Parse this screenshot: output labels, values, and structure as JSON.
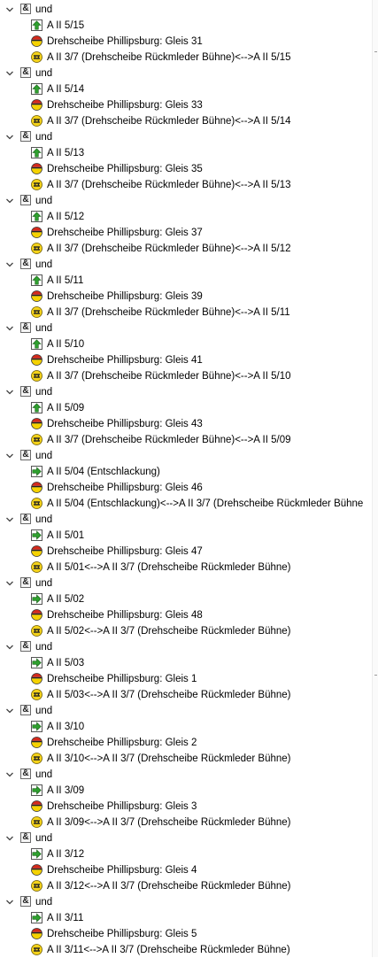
{
  "tree": {
    "groups": [
      {
        "op": "und",
        "green_kind": "up",
        "green": "A II 5/15",
        "gleis": "Drehscheibe Phillipsburg: Gleis 31",
        "link": "A II 3/7 (Drehscheibe Rückmleder Bühne)<-->A II 5/15"
      },
      {
        "op": "und",
        "green_kind": "up",
        "green": "A II 5/14",
        "gleis": "Drehscheibe Phillipsburg: Gleis 33",
        "link": "A II 3/7 (Drehscheibe Rückmleder Bühne)<-->A II 5/14"
      },
      {
        "op": "und",
        "green_kind": "up",
        "green": "A II 5/13",
        "gleis": "Drehscheibe Phillipsburg: Gleis 35",
        "link": "A II 3/7 (Drehscheibe Rückmleder Bühne)<-->A II 5/13"
      },
      {
        "op": "und",
        "green_kind": "up",
        "green": "A II 5/12",
        "gleis": "Drehscheibe Phillipsburg: Gleis 37",
        "link": "A II 3/7 (Drehscheibe Rückmleder Bühne)<-->A II 5/12"
      },
      {
        "op": "und",
        "green_kind": "up",
        "green": "A II 5/11",
        "gleis": "Drehscheibe Phillipsburg: Gleis 39",
        "link": "A II 3/7 (Drehscheibe Rückmleder Bühne)<-->A II 5/11"
      },
      {
        "op": "und",
        "green_kind": "up",
        "green": "A II 5/10",
        "gleis": "Drehscheibe Phillipsburg: Gleis 41",
        "link": "A II 3/7 (Drehscheibe Rückmleder Bühne)<-->A II 5/10"
      },
      {
        "op": "und",
        "green_kind": "up",
        "green": "A II 5/09",
        "gleis": "Drehscheibe Phillipsburg: Gleis 43",
        "link": "A II 3/7 (Drehscheibe Rückmleder Bühne)<-->A II 5/09"
      },
      {
        "op": "und",
        "green_kind": "right",
        "green": "A II 5/04 (Entschlackung)",
        "gleis": "Drehscheibe Phillipsburg: Gleis 46",
        "link": "A II 5/04 (Entschlackung)<-->A II 3/7 (Drehscheibe Rückmleder Bühne"
      },
      {
        "op": "und",
        "green_kind": "right",
        "green": "A II 5/01",
        "gleis": "Drehscheibe Phillipsburg: Gleis 47",
        "link": "A II 5/01<-->A II 3/7 (Drehscheibe Rückmleder Bühne)"
      },
      {
        "op": "und",
        "green_kind": "right",
        "green": "A II 5/02",
        "gleis": "Drehscheibe Phillipsburg: Gleis 48",
        "link": "A II 5/02<-->A II 3/7 (Drehscheibe Rückmleder Bühne)"
      },
      {
        "op": "und",
        "green_kind": "right",
        "green": "A II 5/03",
        "gleis": "Drehscheibe Phillipsburg: Gleis 1",
        "link": "A II 5/03<-->A II 3/7 (Drehscheibe Rückmleder Bühne)"
      },
      {
        "op": "und",
        "green_kind": "right",
        "green": "A II 3/10",
        "gleis": "Drehscheibe Phillipsburg: Gleis 2",
        "link": "A II 3/10<-->A II 3/7 (Drehscheibe Rückmleder Bühne)"
      },
      {
        "op": "und",
        "green_kind": "right",
        "green": "A II 3/09",
        "gleis": "Drehscheibe Phillipsburg: Gleis 3",
        "link": "A II 3/09<-->A II 3/7 (Drehscheibe Rückmleder Bühne)"
      },
      {
        "op": "und",
        "green_kind": "right",
        "green": "A II 3/12",
        "gleis": "Drehscheibe Phillipsburg: Gleis 4",
        "link": "A II 3/12<-->A II 3/7 (Drehscheibe Rückmleder Bühne)"
      },
      {
        "op": "und",
        "green_kind": "right",
        "green": "A II 3/11",
        "gleis": "Drehscheibe Phillipsburg: Gleis 5",
        "link": "A II 3/11<-->A II 3/7 (Drehscheibe Rückmleder Bühne)"
      }
    ]
  },
  "colors": {
    "green_icon": "#2fa02f",
    "signal_red": "#d42a1c",
    "signal_yellow": "#f5d200",
    "link_yellow": "#f4d21a"
  },
  "icons": {
    "expand": "chevron-down-icon",
    "operator": "and-operator-icon",
    "route_up": "arrow-up-icon",
    "route_right": "arrow-right-icon",
    "signal": "signal-disc-icon",
    "link": "link-contact-icon"
  }
}
